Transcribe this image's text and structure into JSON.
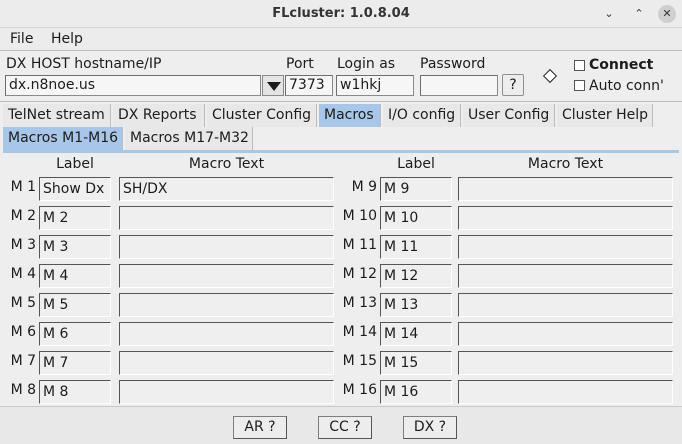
{
  "window": {
    "title": "FLcluster: 1.0.8.04",
    "controls": [
      "⌄",
      "⌃",
      "✕"
    ]
  },
  "menu": {
    "file": "File",
    "help": "Help"
  },
  "host": {
    "host_label": "DX HOST hostname/IP",
    "host_value": "dx.n8noe.us",
    "port_label": "Port",
    "port_value": "7373",
    "login_label": "Login as",
    "login_value": "w1hkj",
    "password_label": "Password",
    "password_value": "",
    "help_btn": "?",
    "connect_label": "Connect",
    "autoconn_label": "Auto conn'"
  },
  "tabs": [
    "TelNet stream",
    "DX Reports",
    "Cluster Config",
    "Macros",
    "I/O config",
    "User Config",
    "Cluster Help"
  ],
  "active_tab": "Macros",
  "subtabs": [
    "Macros M1-M16",
    "Macros M17-M32"
  ],
  "columns": {
    "label": "Label",
    "macro_text": "Macro Text"
  },
  "macros_left": [
    {
      "id": "M 1",
      "label": "Show Dx",
      "text": "SH/DX"
    },
    {
      "id": "M 2",
      "label": "M 2",
      "text": ""
    },
    {
      "id": "M 3",
      "label": "M 3",
      "text": ""
    },
    {
      "id": "M 4",
      "label": "M 4",
      "text": ""
    },
    {
      "id": "M 5",
      "label": "M 5",
      "text": ""
    },
    {
      "id": "M 6",
      "label": "M 6",
      "text": ""
    },
    {
      "id": "M 7",
      "label": "M 7",
      "text": ""
    },
    {
      "id": "M 8",
      "label": "M 8",
      "text": ""
    }
  ],
  "macros_right": [
    {
      "id": "M 9",
      "label": "M 9",
      "text": ""
    },
    {
      "id": "M 10",
      "label": "M 10",
      "text": ""
    },
    {
      "id": "M 11",
      "label": "M 11",
      "text": ""
    },
    {
      "id": "M 12",
      "label": "M 12",
      "text": ""
    },
    {
      "id": "M 13",
      "label": "M 13",
      "text": ""
    },
    {
      "id": "M 14",
      "label": "M 14",
      "text": ""
    },
    {
      "id": "M 15",
      "label": "M 15",
      "text": ""
    },
    {
      "id": "M 16",
      "label": "M 16",
      "text": ""
    }
  ],
  "bottom_buttons": {
    "ar": "AR ?",
    "cc": "CC ?",
    "dx": "DX ?"
  }
}
